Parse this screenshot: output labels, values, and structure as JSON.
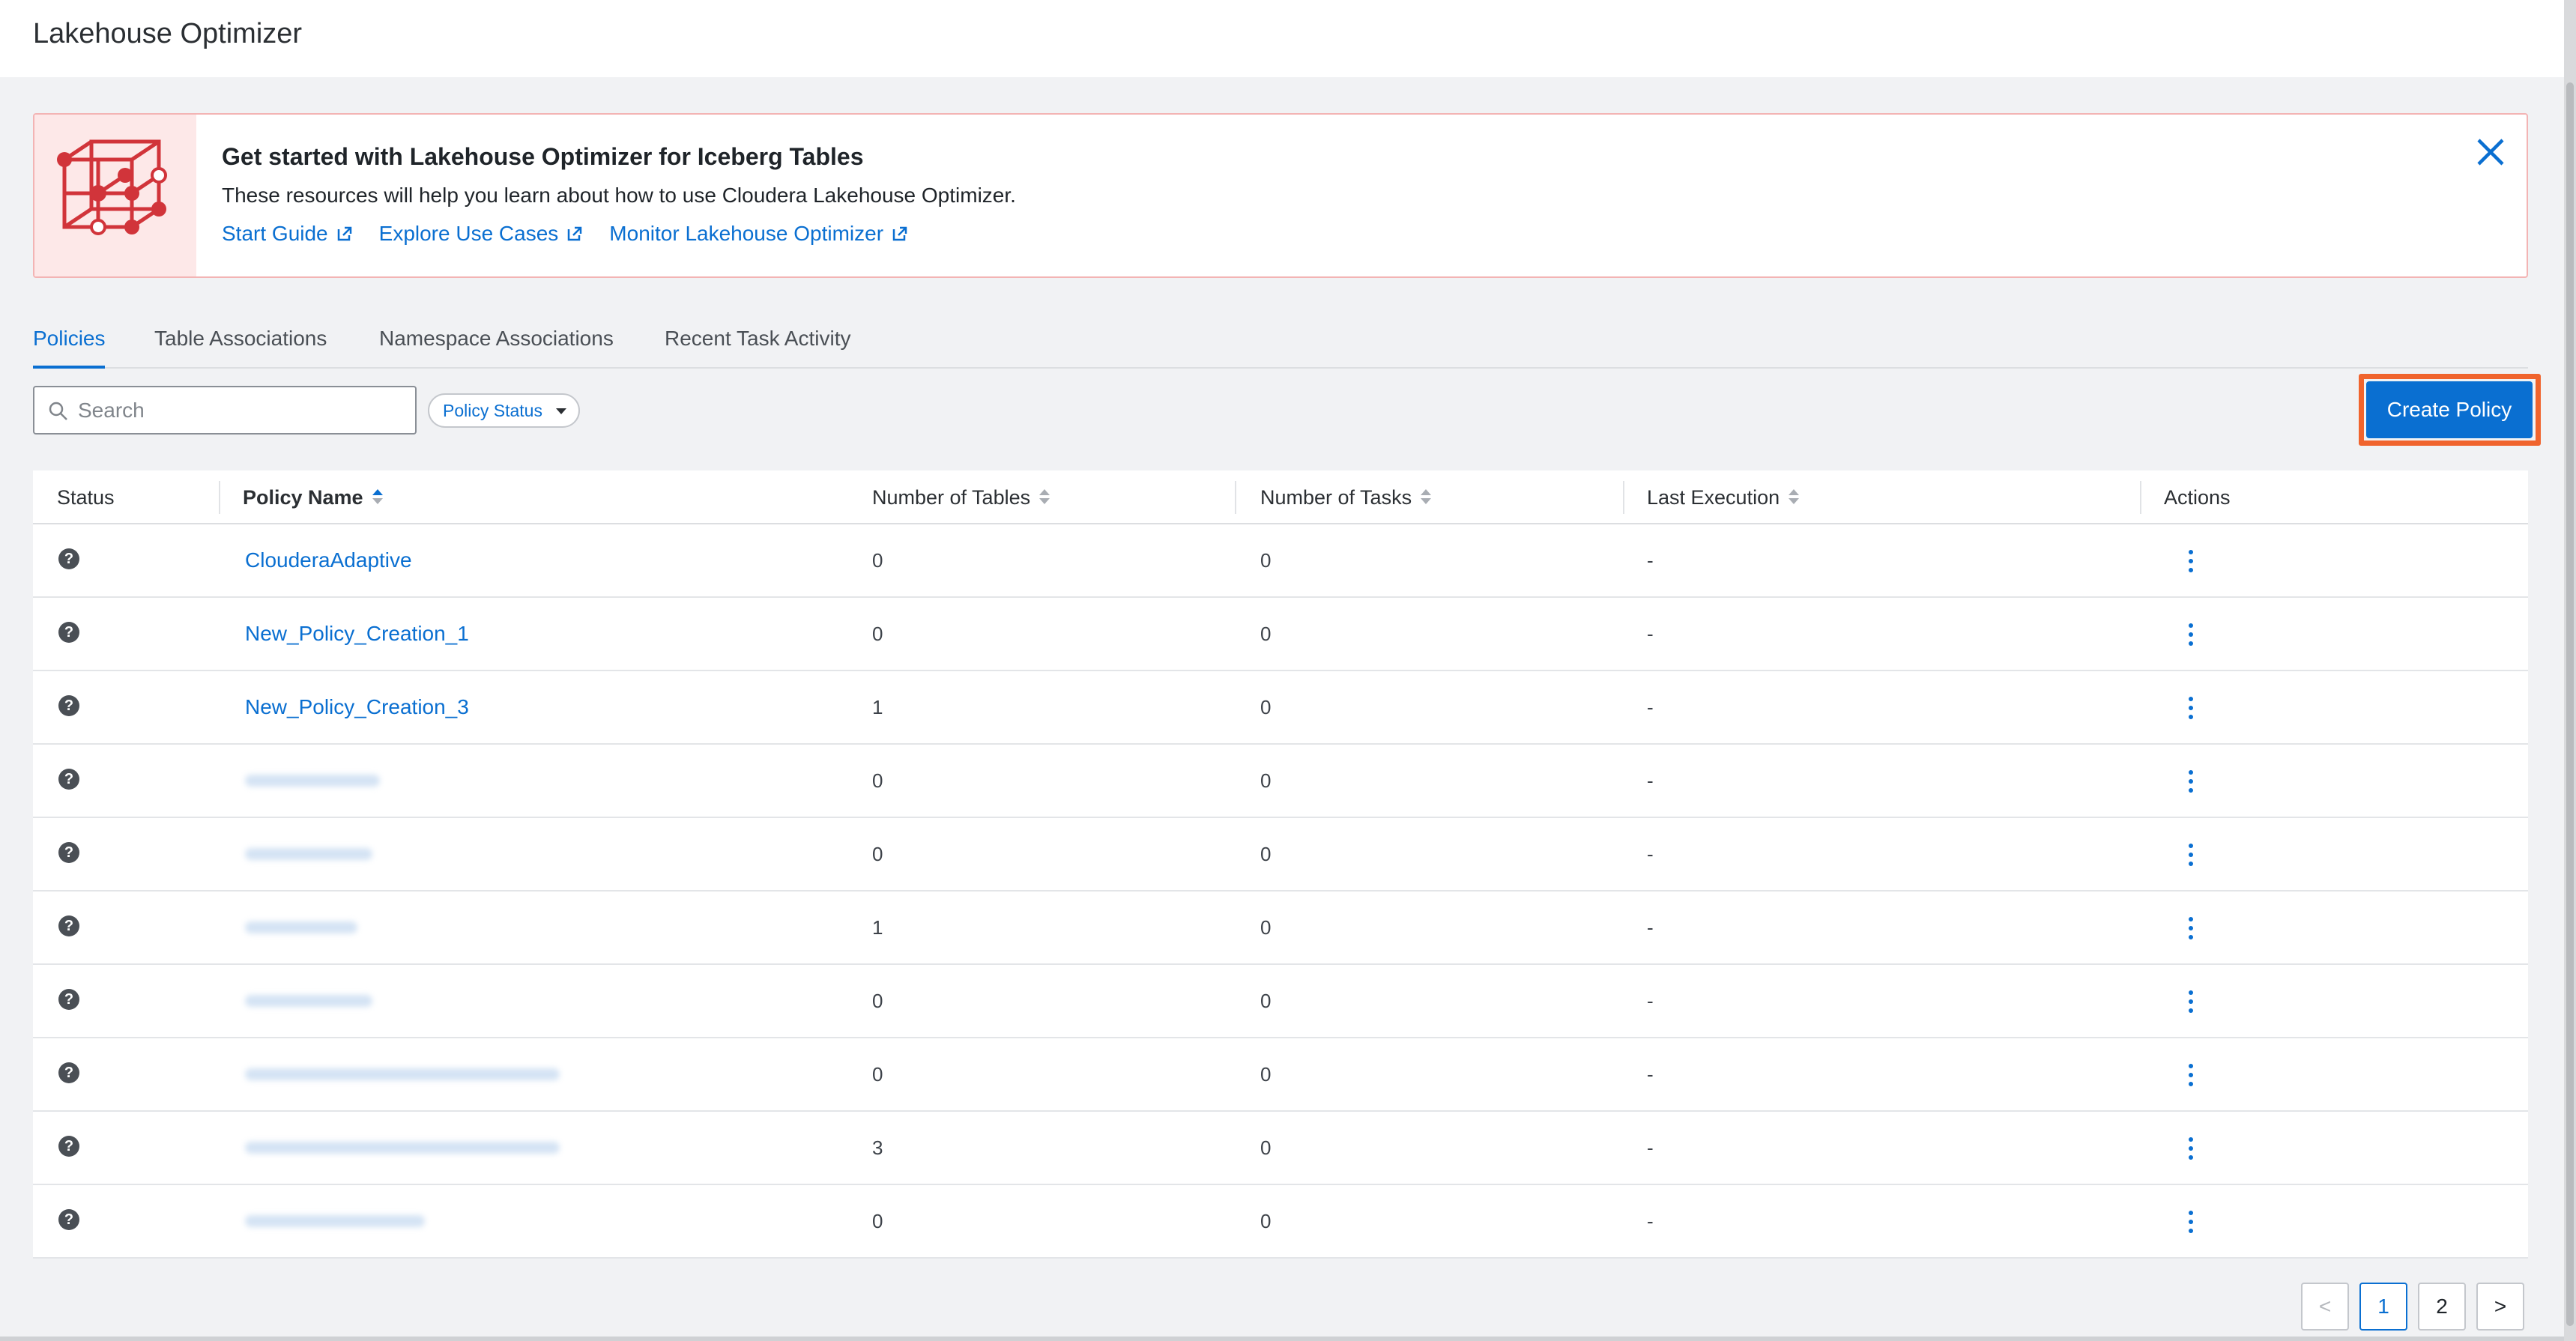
{
  "app": {
    "title": "Lakehouse Optimizer"
  },
  "banner": {
    "title": "Get started with Lakehouse Optimizer for Iceberg Tables",
    "description": "These resources will help you learn about how to use Cloudera Lakehouse Optimizer.",
    "links": [
      "Start Guide",
      "Explore Use Cases",
      "Monitor Lakehouse Optimizer"
    ],
    "icon": "iceberg-cube-icon"
  },
  "tabs": [
    {
      "label": "Policies",
      "active": true
    },
    {
      "label": "Table Associations",
      "active": false
    },
    {
      "label": "Namespace Associations",
      "active": false
    },
    {
      "label": "Recent Task Activity",
      "active": false
    }
  ],
  "toolbar": {
    "search_placeholder": "Search",
    "status_filter_label": "Policy Status",
    "create_label": "Create Policy"
  },
  "table": {
    "columns": [
      "Status",
      "Policy Name",
      "Number of Tables",
      "Number of Tasks",
      "Last Execution",
      "Actions"
    ],
    "sorted_by": "Policy Name",
    "rows": [
      {
        "status": "?",
        "name": "ClouderaAdaptive",
        "tables": "0",
        "tasks": "0",
        "last_execution": "-"
      },
      {
        "status": "?",
        "name": "New_Policy_Creation_1",
        "tables": "0",
        "tasks": "0",
        "last_execution": "-"
      },
      {
        "status": "?",
        "name": "New_Policy_Creation_3",
        "tables": "1",
        "tasks": "0",
        "last_execution": "-"
      },
      {
        "status": "?",
        "name": "",
        "tables": "0",
        "tasks": "0",
        "last_execution": "-"
      },
      {
        "status": "?",
        "name": "",
        "tables": "0",
        "tasks": "0",
        "last_execution": "-"
      },
      {
        "status": "?",
        "name": "",
        "tables": "1",
        "tasks": "0",
        "last_execution": "-"
      },
      {
        "status": "?",
        "name": "",
        "tables": "0",
        "tasks": "0",
        "last_execution": "-"
      },
      {
        "status": "?",
        "name": "",
        "tables": "0",
        "tasks": "0",
        "last_execution": "-"
      },
      {
        "status": "?",
        "name": "",
        "tables": "3",
        "tasks": "0",
        "last_execution": "-"
      },
      {
        "status": "?",
        "name": "",
        "tables": "0",
        "tasks": "0",
        "last_execution": "-"
      }
    ]
  },
  "pagination": {
    "prev": "<",
    "pages": [
      "1",
      "2"
    ],
    "current": "1",
    "next": ">"
  },
  "colors": {
    "accent": "#0a6fd1",
    "highlight": "#f0642d",
    "banner_border": "#f3b4b4",
    "cube": "#d1343a"
  }
}
